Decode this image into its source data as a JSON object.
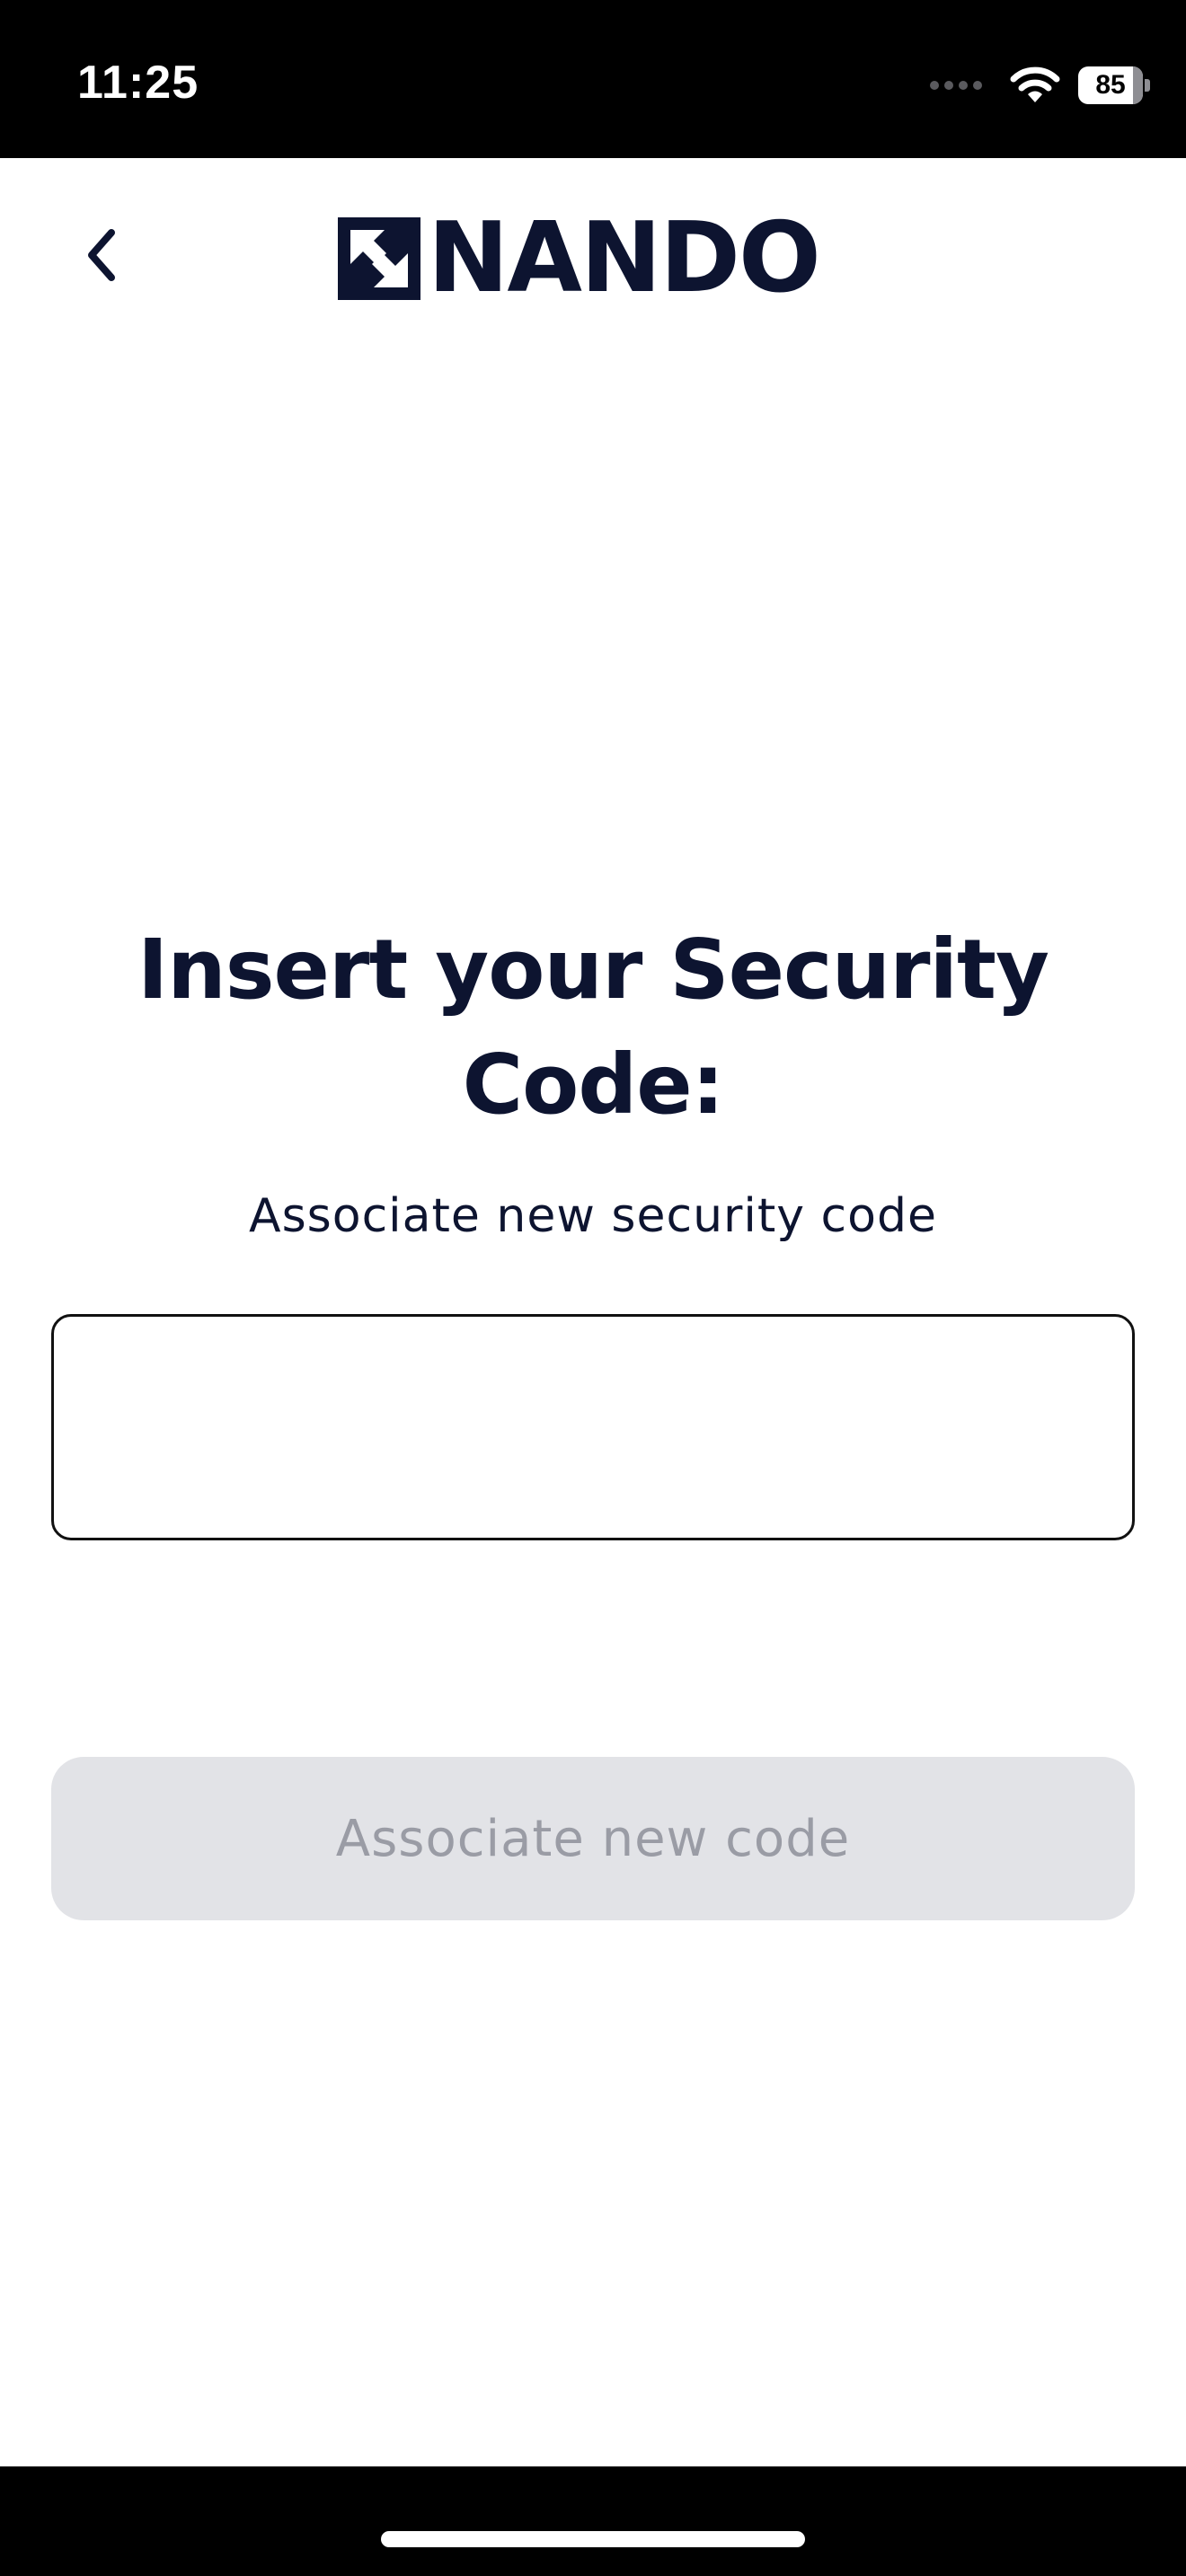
{
  "status_bar": {
    "time": "11:25",
    "battery_percent": "85",
    "battery_level": 0.85,
    "icons": [
      "cellular-signal-icon",
      "wifi-icon",
      "battery-icon"
    ]
  },
  "header": {
    "back_icon": "chevron-left-icon",
    "logo_text": "NANDO"
  },
  "main": {
    "title": "Insert your Security Code:",
    "subtitle": "Associate new security code",
    "input": {
      "value": "",
      "placeholder": ""
    },
    "submit_label": "Associate new code",
    "submit_state": "disabled"
  },
  "colors": {
    "brand_navy": "#0d1430",
    "disabled_button_bg": "#e2e3e7",
    "disabled_button_text": "#9a9ca5",
    "input_border": "#111111"
  }
}
